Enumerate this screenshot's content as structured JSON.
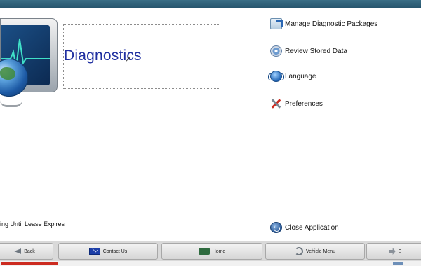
{
  "title": "Diagnostics",
  "menu": [
    {
      "label": "Manage Diagnostic Packages",
      "icon": "package-icon"
    },
    {
      "label": "Review Stored Data",
      "icon": "disc-icon"
    },
    {
      "label": "Language",
      "icon": "language-icon"
    },
    {
      "label": "Preferences",
      "icon": "tools-icon"
    }
  ],
  "close_application": {
    "label": "Close Application",
    "icon": "power-icon"
  },
  "lease_text": "ing Until Lease Expires",
  "nav": [
    {
      "label": "Back",
      "icon": "back-arrow-icon"
    },
    {
      "label": "Contact Us",
      "icon": "envelope-icon"
    },
    {
      "label": "Home",
      "icon": "home-device-icon"
    },
    {
      "label": "Vehicle Menu",
      "icon": "vehicle-menu-icon"
    },
    {
      "label": "E",
      "icon": "exit-icon"
    }
  ],
  "colors": {
    "title": "#1f2fa0",
    "nav_background": "#d9d9d9",
    "topbar": "#25536b"
  }
}
